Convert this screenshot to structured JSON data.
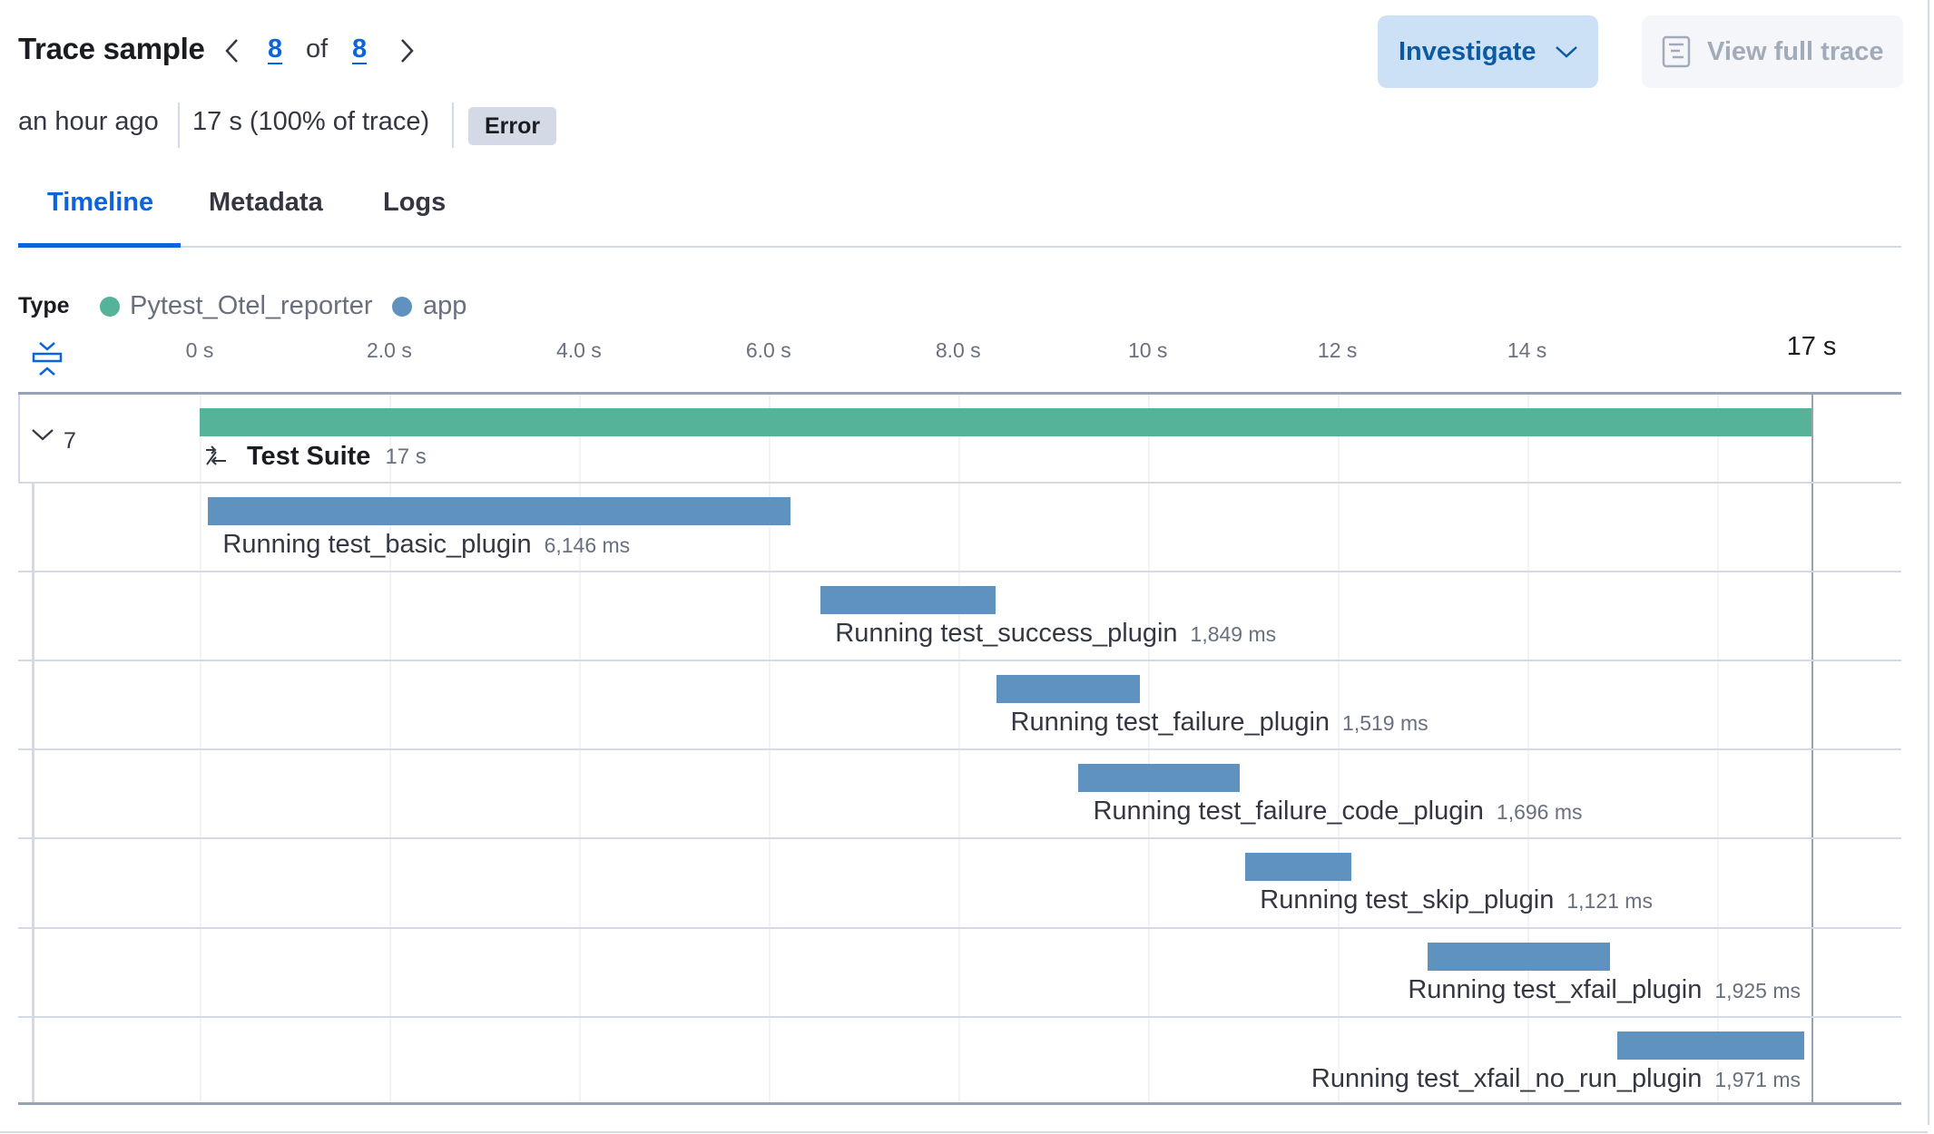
{
  "header": {
    "title": "Trace sample",
    "pager": {
      "current": "8",
      "of_label": "of",
      "total": "8"
    },
    "investigate_label": "Investigate",
    "view_full_trace_label": "View full trace"
  },
  "meta": {
    "time_ago": "an hour ago",
    "duration": "17 s (100% of trace)",
    "status_badge": "Error"
  },
  "tabs": [
    {
      "label": "Timeline",
      "active": true
    },
    {
      "label": "Metadata",
      "active": false
    },
    {
      "label": "Logs",
      "active": false
    }
  ],
  "legend": {
    "label": "Type",
    "items": [
      {
        "name": "Pytest_Otel_reporter",
        "color": "#54b399"
      },
      {
        "name": "app",
        "color": "#6092c0"
      }
    ]
  },
  "colors": {
    "accent": "#0b64dd",
    "reporter": "#54b399",
    "app": "#6092c0"
  },
  "chart_data": {
    "type": "waterfall",
    "x_unit": "s",
    "x_range": [
      0,
      17
    ],
    "tick_labels": [
      "0 s",
      "2.0 s",
      "4.0 s",
      "6.0 s",
      "8.0 s",
      "10 s",
      "12 s",
      "14 s",
      "17 s"
    ],
    "tick_values": [
      0,
      2,
      4,
      6,
      8,
      10,
      12,
      14,
      17
    ],
    "root": {
      "name": "Test Suite",
      "duration_label": "17 s",
      "start_s": 0,
      "duration_s": 17,
      "type": "Pytest_Otel_reporter",
      "child_count": "7"
    },
    "spans": [
      {
        "name": "Running test_basic_plugin",
        "duration_label": "6,146 ms",
        "start_s": 0.09,
        "duration_s": 6.146,
        "type": "app"
      },
      {
        "name": "Running test_success_plugin",
        "duration_label": "1,849 ms",
        "start_s": 6.55,
        "duration_s": 1.849,
        "type": "app"
      },
      {
        "name": "Running test_failure_plugin",
        "duration_label": "1,519 ms",
        "start_s": 8.4,
        "duration_s": 1.519,
        "type": "app"
      },
      {
        "name": "Running test_failure_code_plugin",
        "duration_label": "1,696 ms",
        "start_s": 9.27,
        "duration_s": 1.696,
        "type": "app"
      },
      {
        "name": "Running test_skip_plugin",
        "duration_label": "1,121 ms",
        "start_s": 11.03,
        "duration_s": 1.121,
        "type": "app"
      },
      {
        "name": "Running test_xfail_plugin",
        "duration_label": "1,925 ms",
        "start_s": 12.95,
        "duration_s": 1.925,
        "type": "app"
      },
      {
        "name": "Running test_xfail_no_run_plugin",
        "duration_label": "1,971 ms",
        "start_s": 14.95,
        "duration_s": 1.971,
        "type": "app"
      }
    ]
  }
}
